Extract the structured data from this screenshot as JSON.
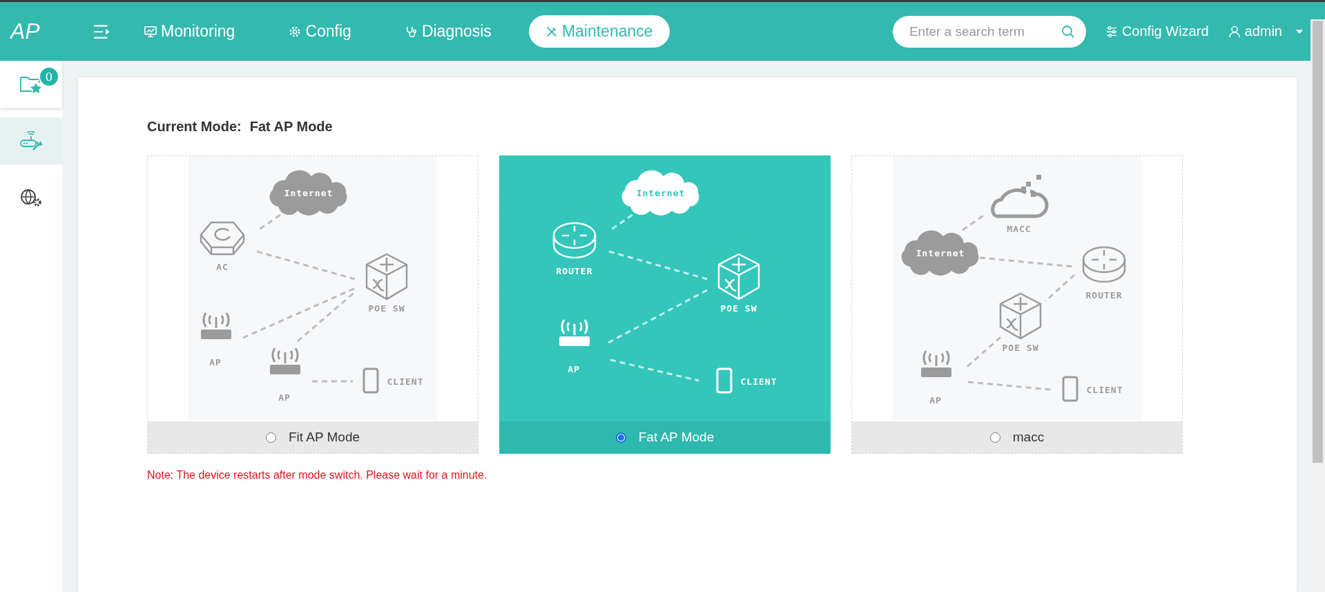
{
  "header": {
    "logo": "AP",
    "nav": [
      {
        "kind": "monitoring",
        "label": "Monitoring",
        "selected": false
      },
      {
        "kind": "config",
        "label": "Config",
        "selected": false
      },
      {
        "kind": "diagnosis",
        "label": "Diagnosis",
        "selected": false
      },
      {
        "kind": "maintenance",
        "label": "Maintenance",
        "selected": true
      }
    ],
    "search": {
      "placeholder": "Enter a search term"
    },
    "wizard": "Config Wizard",
    "user": "admin"
  },
  "sidebar": {
    "items": [
      {
        "kind": "favorites",
        "badge": "0",
        "selected": false
      },
      {
        "kind": "device",
        "selected": true
      },
      {
        "kind": "network",
        "selected": false
      }
    ]
  },
  "current_mode": {
    "label": "Current Mode:",
    "value": "Fat AP Mode"
  },
  "modes": [
    {
      "label": "Fit AP Mode",
      "selected": false,
      "diagram": {
        "nodes": [
          {
            "kind": "cloud",
            "label": "Internet"
          },
          {
            "kind": "ac",
            "label": "AC"
          },
          {
            "kind": "switch",
            "label": "POE SW"
          },
          {
            "kind": "ap",
            "label": "AP"
          },
          {
            "kind": "ap",
            "label": "AP"
          },
          {
            "kind": "client",
            "label": "CLIENT"
          }
        ]
      }
    },
    {
      "label": "Fat AP Mode",
      "selected": true,
      "diagram": {
        "nodes": [
          {
            "kind": "cloud",
            "label": "Internet"
          },
          {
            "kind": "router",
            "label": "ROUTER"
          },
          {
            "kind": "switch",
            "label": "POE SW"
          },
          {
            "kind": "ap",
            "label": "AP"
          },
          {
            "kind": "client",
            "label": "CLIENT"
          }
        ]
      }
    },
    {
      "label": "macc",
      "selected": false,
      "diagram": {
        "nodes": [
          {
            "kind": "macc",
            "label": "MACC"
          },
          {
            "kind": "cloud",
            "label": "Internet"
          },
          {
            "kind": "router",
            "label": "ROUTER"
          },
          {
            "kind": "switch",
            "label": "POE SW"
          },
          {
            "kind": "ap",
            "label": "AP"
          },
          {
            "kind": "client",
            "label": "CLIENT"
          }
        ]
      }
    }
  ],
  "note": "Note: The device restarts after mode switch. Please wait for a minute."
}
